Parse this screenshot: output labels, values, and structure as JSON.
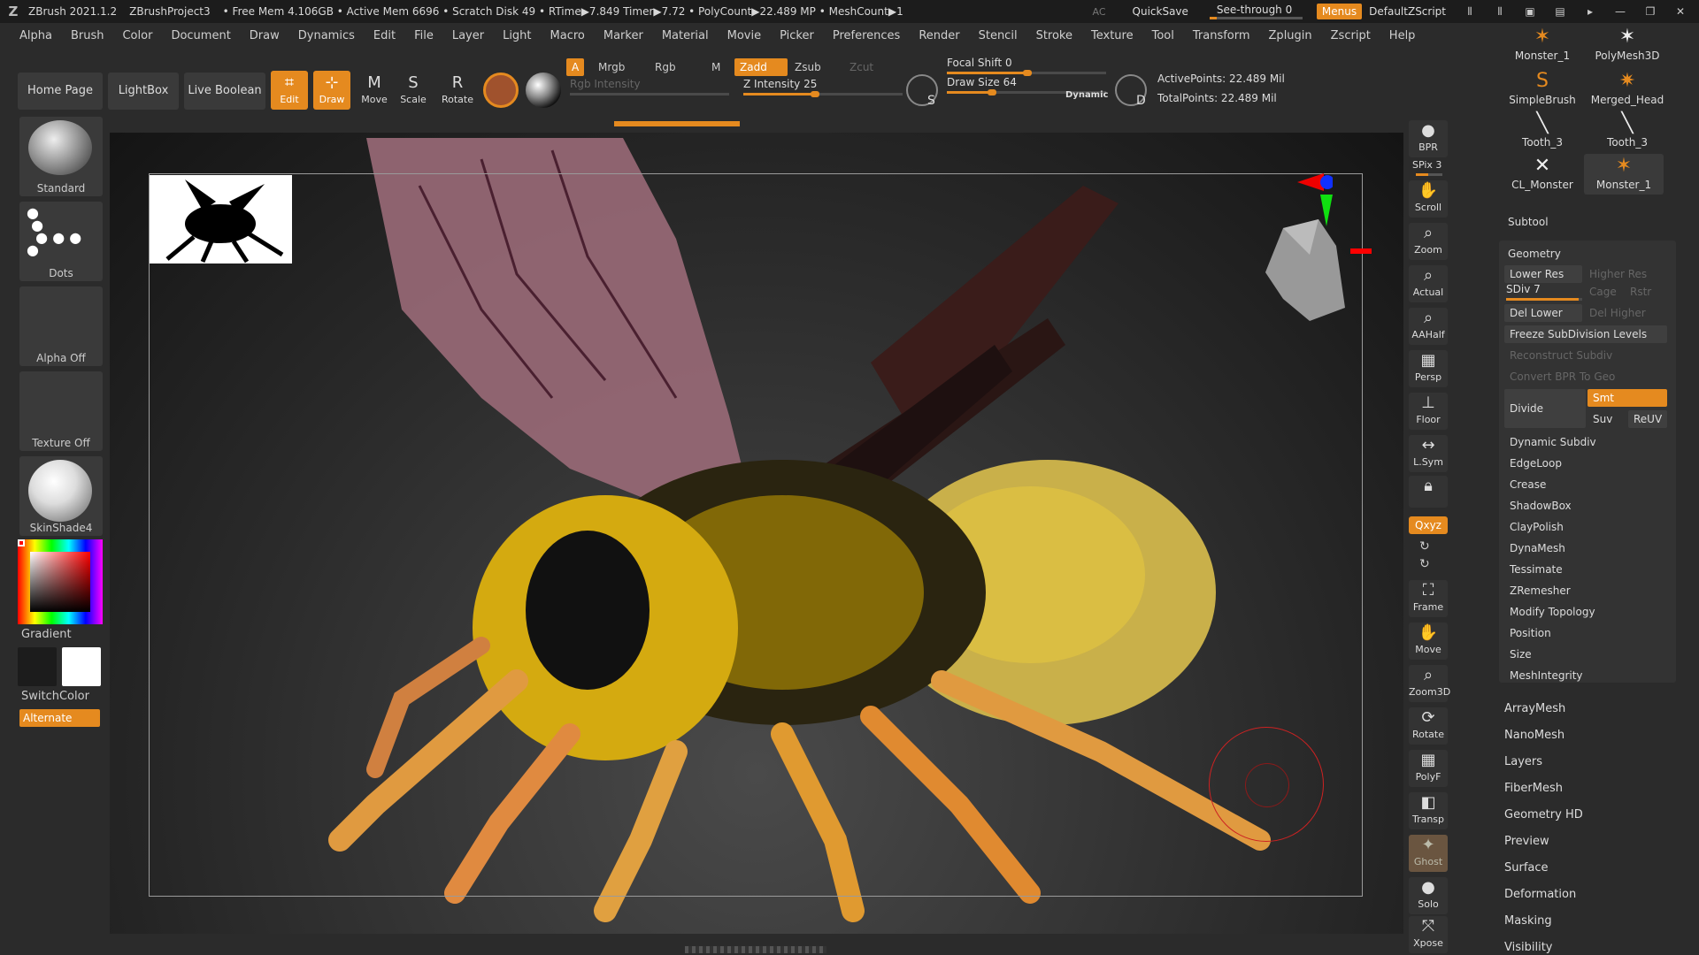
{
  "titlebar": {
    "app": "ZBrush 2021.1.2",
    "project": "ZBrushProject3",
    "stats": "• Free Mem 4.106GB • Active Mem 6696 • Scratch Disk 49 • RTime▶7.849 Timer▶7.72 • PolyCount▶22.489 MP • MeshCount▶1",
    "ac": "AC",
    "quicksave": "QuickSave",
    "seethrough": "See-through  0",
    "seethrough_value": 0,
    "menus": "Menus",
    "default_script": "DefaultZScript"
  },
  "menubar": [
    "Alpha",
    "Brush",
    "Color",
    "Document",
    "Draw",
    "Dynamics",
    "Edit",
    "File",
    "Layer",
    "Light",
    "Macro",
    "Marker",
    "Material",
    "Movie",
    "Picker",
    "Preferences",
    "Render",
    "Stencil",
    "Stroke",
    "Texture",
    "Tool",
    "Transform",
    "Zplugin",
    "Zscript",
    "Help"
  ],
  "toolbar": {
    "home_page": "Home Page",
    "lightbox": "LightBox",
    "live_boolean": "Live Boolean",
    "edit": "Edit",
    "draw": "Draw",
    "move": "Move",
    "scale": "Scale",
    "rotate": "Rotate",
    "a": "A",
    "mrgb": "Mrgb",
    "rgb": "Rgb",
    "m": "M",
    "rgb_intensity": "Rgb Intensity",
    "zadd": "Zadd",
    "zsub": "Zsub",
    "zcut": "Zcut",
    "z_intensity": "Z Intensity 25",
    "z_intensity_value": 25,
    "focal_shift": "Focal Shift 0",
    "focal_shift_value": 0,
    "draw_size": "Draw Size 64",
    "draw_size_value": 64,
    "dynamic": "Dynamic",
    "s_label": "S",
    "d_label": "D",
    "active_points": "ActivePoints: 22.489 Mil",
    "total_points": "TotalPoints: 22.489 Mil"
  },
  "leftshelf": {
    "brush": "Standard",
    "stroke": "Dots",
    "alpha": "Alpha Off",
    "texture": "Texture Off",
    "material": "SkinShade4",
    "gradient": "Gradient",
    "switchcolor": "SwitchColor",
    "alternate": "Alternate"
  },
  "rightcol": {
    "bpr": "BPR",
    "spix": "SPix 3",
    "scroll": "Scroll",
    "zoom": "Zoom",
    "actual": "Actual",
    "aahalf": "AAHalf",
    "persp": "Persp",
    "floor": "Floor",
    "lsym": "L.Sym",
    "xyz": "Qxyz",
    "frame": "Frame",
    "move": "Move",
    "zoom3d": "Zoom3D",
    "rotate": "Rotate",
    "polyf": "PolyF",
    "transp": "Transp",
    "ghost": "Ghost",
    "solo": "Solo",
    "xpose": "Xpose"
  },
  "palette": {
    "subtools": [
      {
        "name": "Monster_1"
      },
      {
        "name": "PolyMesh3D"
      },
      {
        "name": "SimpleBrush"
      },
      {
        "name": "Merged_Head"
      },
      {
        "name": "Tooth_3"
      },
      {
        "name": "Tooth_3"
      },
      {
        "name": "CL_Monster"
      },
      {
        "name": "Monster_1"
      }
    ],
    "subtool": "Subtool",
    "geometry": "Geometry",
    "lower_res": "Lower Res",
    "higher_res": "Higher Res",
    "sdiv": "SDiv 7",
    "cage": "Cage",
    "rstr": "Rstr",
    "del_lower": "Del Lower",
    "del_higher": "Del Higher",
    "freeze": "Freeze SubDivision Levels",
    "reconstruct": "Reconstruct Subdiv",
    "convert_bpr": "Convert BPR To Geo",
    "divide": "Divide",
    "smt": "Smt",
    "suv": "Suv",
    "reuv": "ReUV",
    "geo_items": [
      "Dynamic Subdiv",
      "EdgeLoop",
      "Crease",
      "ShadowBox",
      "ClayPolish",
      "DynaMesh",
      "Tessimate",
      "ZRemesher",
      "Modify Topology",
      "Position",
      "Size",
      "MeshIntegrity"
    ],
    "sections": [
      "ArrayMesh",
      "NanoMesh",
      "Layers",
      "FiberMesh",
      "Geometry HD",
      "Preview",
      "Surface",
      "Deformation",
      "Masking",
      "Visibility"
    ]
  },
  "colors": {
    "accent": "#e58a1f",
    "panel": "#2b2b2b",
    "button": "#3a3a3a"
  }
}
